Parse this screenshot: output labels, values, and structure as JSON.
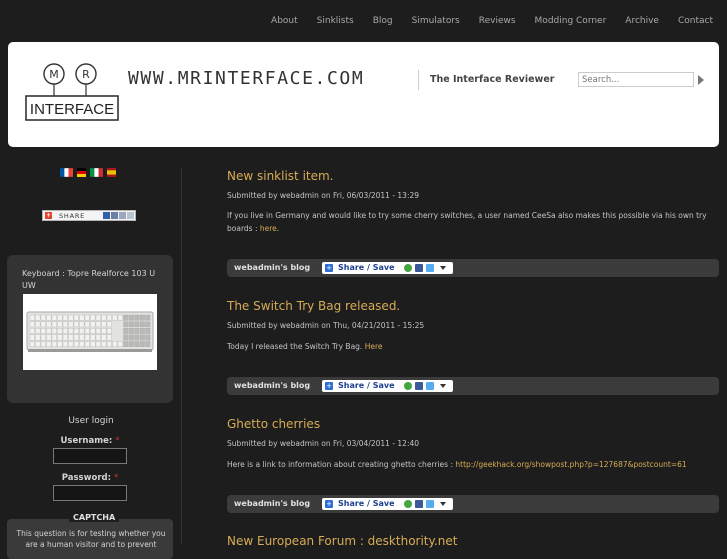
{
  "nav": {
    "items": [
      "About",
      "Sinklists",
      "Blog",
      "Simulators",
      "Reviews",
      "Modding Corner",
      "Archive",
      "Contact"
    ]
  },
  "header": {
    "logo_m": "M",
    "logo_r": "R",
    "logo_text": "INTERFACE",
    "site_url": "WWW.MRINTERFACE.COM",
    "slogan": "The Interface Reviewer",
    "search_placeholder": "Search..."
  },
  "sidebar": {
    "share_label": "SHARE",
    "keyboard_label": "Keyboard : Topre Realforce 103 U UW",
    "login": {
      "title": "User login",
      "username_label": "Username:",
      "password_label": "Password:",
      "required_mark": "*"
    },
    "captcha": {
      "legend": "CAPTCHA",
      "description": "This question is for testing whether you are a human visitor and to prevent"
    }
  },
  "posts": [
    {
      "title": "New sinklist item.",
      "meta": "Submitted by webadmin on Fri, 06/03/2011 - 13:29",
      "body": "If you live in Germany and would like to try some cherry switches, a user named CeeSa also makes this possible via his own try boards :",
      "link": "here",
      "link_suffix": "."
    },
    {
      "title": "The Switch Try Bag released.",
      "meta": "Submitted by webadmin on Thu, 04/21/2011 - 15:25",
      "body": "Today I released the Switch Try Bag.",
      "link": "Here",
      "link_suffix": ""
    },
    {
      "title": "Ghetto cherries",
      "meta": "Submitted by webadmin on Fri, 03/04/2011 - 12:40",
      "body": "Here is a link to information about creating ghetto cherries :",
      "link": "http://geekhack.org/showpost.php?p=127687&postcount=61",
      "link_suffix": ""
    },
    {
      "title": "New European Forum : deskthority.net"
    }
  ],
  "post_bar": {
    "blog_link": "webadmin's blog",
    "share_label": "Share / Save"
  }
}
